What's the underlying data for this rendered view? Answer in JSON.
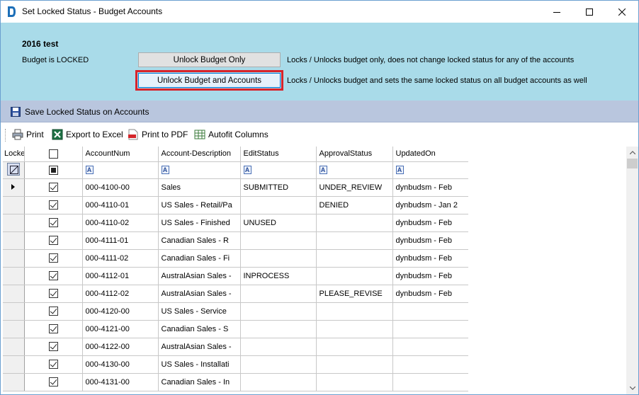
{
  "window": {
    "title": "Set Locked Status - Budget Accounts"
  },
  "budget": {
    "name": "2016 test",
    "status": "Budget is LOCKED",
    "unlock_only_label": "Unlock Budget Only",
    "unlock_only_desc": "Locks / Unlocks budget only, does not change locked status for any of the accounts",
    "unlock_all_label": "Unlock Budget and Accounts",
    "unlock_all_desc": "Locks / Unlocks budget and sets the same locked status on all budget accounts as well"
  },
  "save_bar": {
    "label": "Save Locked Status on Accounts"
  },
  "toolbar": {
    "print": "Print",
    "export_excel": "Export to Excel",
    "print_pdf": "Print to PDF",
    "autofit": "Autofit Columns"
  },
  "grid": {
    "columns": [
      "Locked",
      "AccountNum",
      "Account-Description",
      "EditStatus",
      "ApprovalStatus",
      "UpdatedOn"
    ],
    "rows": [
      {
        "account": "000-4100-00",
        "desc": "Sales",
        "edit": "SUBMITTED",
        "approval": "UNDER_REVIEW",
        "updated": "dynbudsm - Feb",
        "locked": true
      },
      {
        "account": "000-4110-01",
        "desc": "US Sales - Retail/Pa",
        "edit": "",
        "approval": "DENIED",
        "updated": "dynbudsm - Jan 2",
        "locked": true
      },
      {
        "account": "000-4110-02",
        "desc": "US Sales - Finished",
        "edit": "UNUSED",
        "approval": "",
        "updated": "dynbudsm - Feb",
        "locked": true
      },
      {
        "account": "000-4111-01",
        "desc": "Canadian Sales - R",
        "edit": "",
        "approval": "",
        "updated": "dynbudsm - Feb",
        "locked": true
      },
      {
        "account": "000-4111-02",
        "desc": "Canadian Sales - Fi",
        "edit": "",
        "approval": "",
        "updated": "dynbudsm - Feb",
        "locked": true
      },
      {
        "account": "000-4112-01",
        "desc": "AustralAsian Sales -",
        "edit": "INPROCESS",
        "approval": "",
        "updated": "dynbudsm - Feb",
        "locked": true
      },
      {
        "account": "000-4112-02",
        "desc": "AustralAsian Sales -",
        "edit": "",
        "approval": "PLEASE_REVISE",
        "updated": "dynbudsm - Feb",
        "locked": true
      },
      {
        "account": "000-4120-00",
        "desc": "US Sales - Service",
        "edit": "",
        "approval": "",
        "updated": "",
        "locked": true
      },
      {
        "account": "000-4121-00",
        "desc": "Canadian Sales - S",
        "edit": "",
        "approval": "",
        "updated": "",
        "locked": true
      },
      {
        "account": "000-4122-00",
        "desc": "AustralAsian Sales -",
        "edit": "",
        "approval": "",
        "updated": "",
        "locked": true
      },
      {
        "account": "000-4130-00",
        "desc": "US Sales - Installati",
        "edit": "",
        "approval": "",
        "updated": "",
        "locked": true
      },
      {
        "account": "000-4131-00",
        "desc": "Canadian Sales - In",
        "edit": "",
        "approval": "",
        "updated": "",
        "locked": true
      }
    ]
  },
  "colors": {
    "top_panel": "#a9dbe9",
    "save_bar": "#b9c6de",
    "highlight": "#d9232a"
  }
}
